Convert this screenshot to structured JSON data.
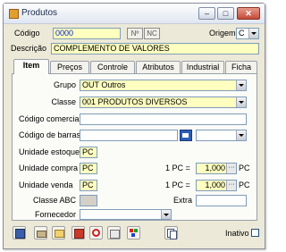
{
  "window": {
    "title": "Produtos"
  },
  "header": {
    "codigo_label": "Código",
    "codigo_value": "0000",
    "n_button": "Nº",
    "nc_button": "NC",
    "origem_label": "Origem",
    "origem_value": "C",
    "descricao_label": "Descrição",
    "descricao_value": "COMPLEMENTO DE VALORES"
  },
  "tabs": [
    {
      "label": "Item",
      "active": true
    },
    {
      "label": "Preços",
      "active": false
    },
    {
      "label": "Controle",
      "active": false
    },
    {
      "label": "Atributos",
      "active": false
    },
    {
      "label": "Industrial",
      "active": false
    },
    {
      "label": "Ficha",
      "active": false
    }
  ],
  "form": {
    "grupo_label": "Grupo",
    "grupo_value": "OUT  Outros",
    "classe_label": "Classe",
    "classe_value": "001    PRODUTOS DIVERSOS",
    "codigo_comercial_label": "Código comercial",
    "codigo_comercial_value": "",
    "codigo_barras_label": "Código de barras",
    "codigo_barras_value": "",
    "unidade_estoque_label": "Unidade estoque",
    "unidade_estoque_value": "PC",
    "unidade_compra_label": "Unidade compra",
    "unidade_compra_value": "PC",
    "compra_conv_label": "1 PC =",
    "compra_conv_value": "1,000",
    "compra_conv_unit": "PC",
    "unidade_venda_label": "Unidade venda",
    "unidade_venda_value": "PC",
    "venda_conv_label": "1 PC =",
    "venda_conv_value": "1,000",
    "venda_conv_unit": "PC",
    "classe_abc_label": "Classe ABC",
    "classe_abc_value": "",
    "extra_label": "Extra",
    "extra_value": "",
    "fornecedor_label": "Fornecedor",
    "fornecedor_value": ""
  },
  "toolbar": {
    "icons": [
      "save-icon",
      "print-icon",
      "folder-icon",
      "delete-icon",
      "cancel-icon",
      "export-icon",
      "colors-icon",
      "copy-icon"
    ],
    "inativo_label": "Inativo",
    "inativo_checked": false
  },
  "colors": {
    "required_field": "#ffffc0",
    "tab_bg": "#fbfbf8",
    "window_bg": "#ece9d8"
  }
}
